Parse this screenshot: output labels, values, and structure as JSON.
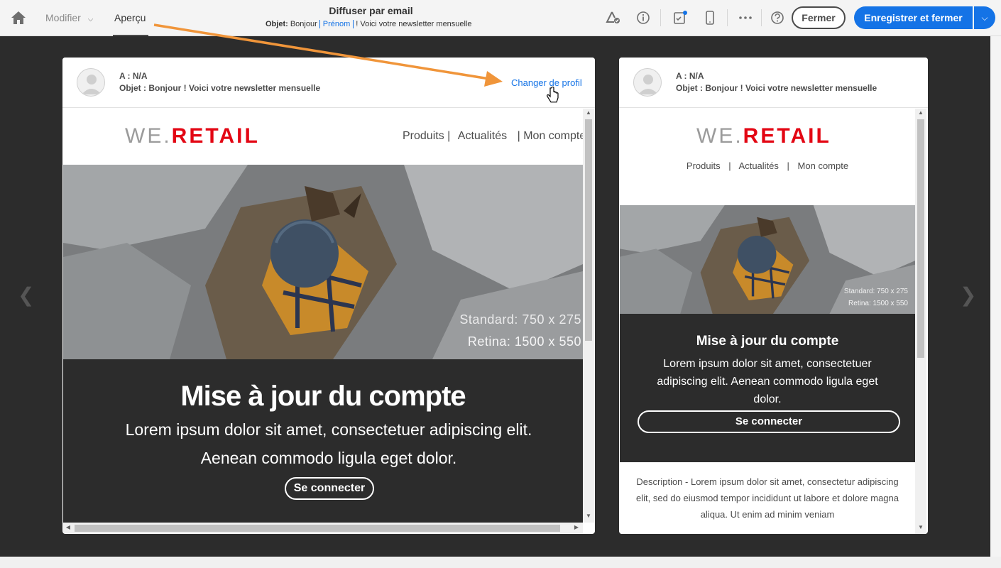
{
  "toolbar": {
    "tab_modify": "Modifier",
    "tab_preview": "Aperçu",
    "title": "Diffuser par email",
    "subject_label": "Objet:",
    "subject_part1": "Bonjour",
    "subject_personalization": "Prénom",
    "subject_part2": "! Voici votre newsletter mensuelle",
    "close_label": "Fermer",
    "save_label": "Enregistrer et fermer",
    "accent_color": "#1473e6"
  },
  "preview_header": {
    "to_line": "A : N/A",
    "subject_line": "Objet : Bonjour  ! Voici votre newsletter mensuelle",
    "change_profile": "Changer de profil"
  },
  "email": {
    "logo_we": "WE.",
    "logo_retail": "RETAIL",
    "nav": [
      "Produits",
      "Actualités",
      "Mon compte"
    ],
    "nav_separator": "|",
    "hero_caption_standard": "Standard: 750 x 275",
    "hero_caption_retina": "Retina: 1500 x 550",
    "section_title": "Mise à jour du compte",
    "section_line1": "Lorem ipsum dolor sit amet, consectetuer adipiscing elit.",
    "section_line2": "Aenean commodo ligula eget dolor.",
    "section_body_mobile": "Lorem ipsum dolor sit amet, consectetuer adipiscing elit. Aenean commodo ligula eget dolor.",
    "cta_label": "Se connecter",
    "description": "Description - Lorem ipsum dolor sit amet, consectetur adipiscing elit, sed do eiusmod tempor incididunt ut labore et dolore magna aliqua. Ut enim ad minim veniam",
    "brand_red": "#e30613"
  }
}
